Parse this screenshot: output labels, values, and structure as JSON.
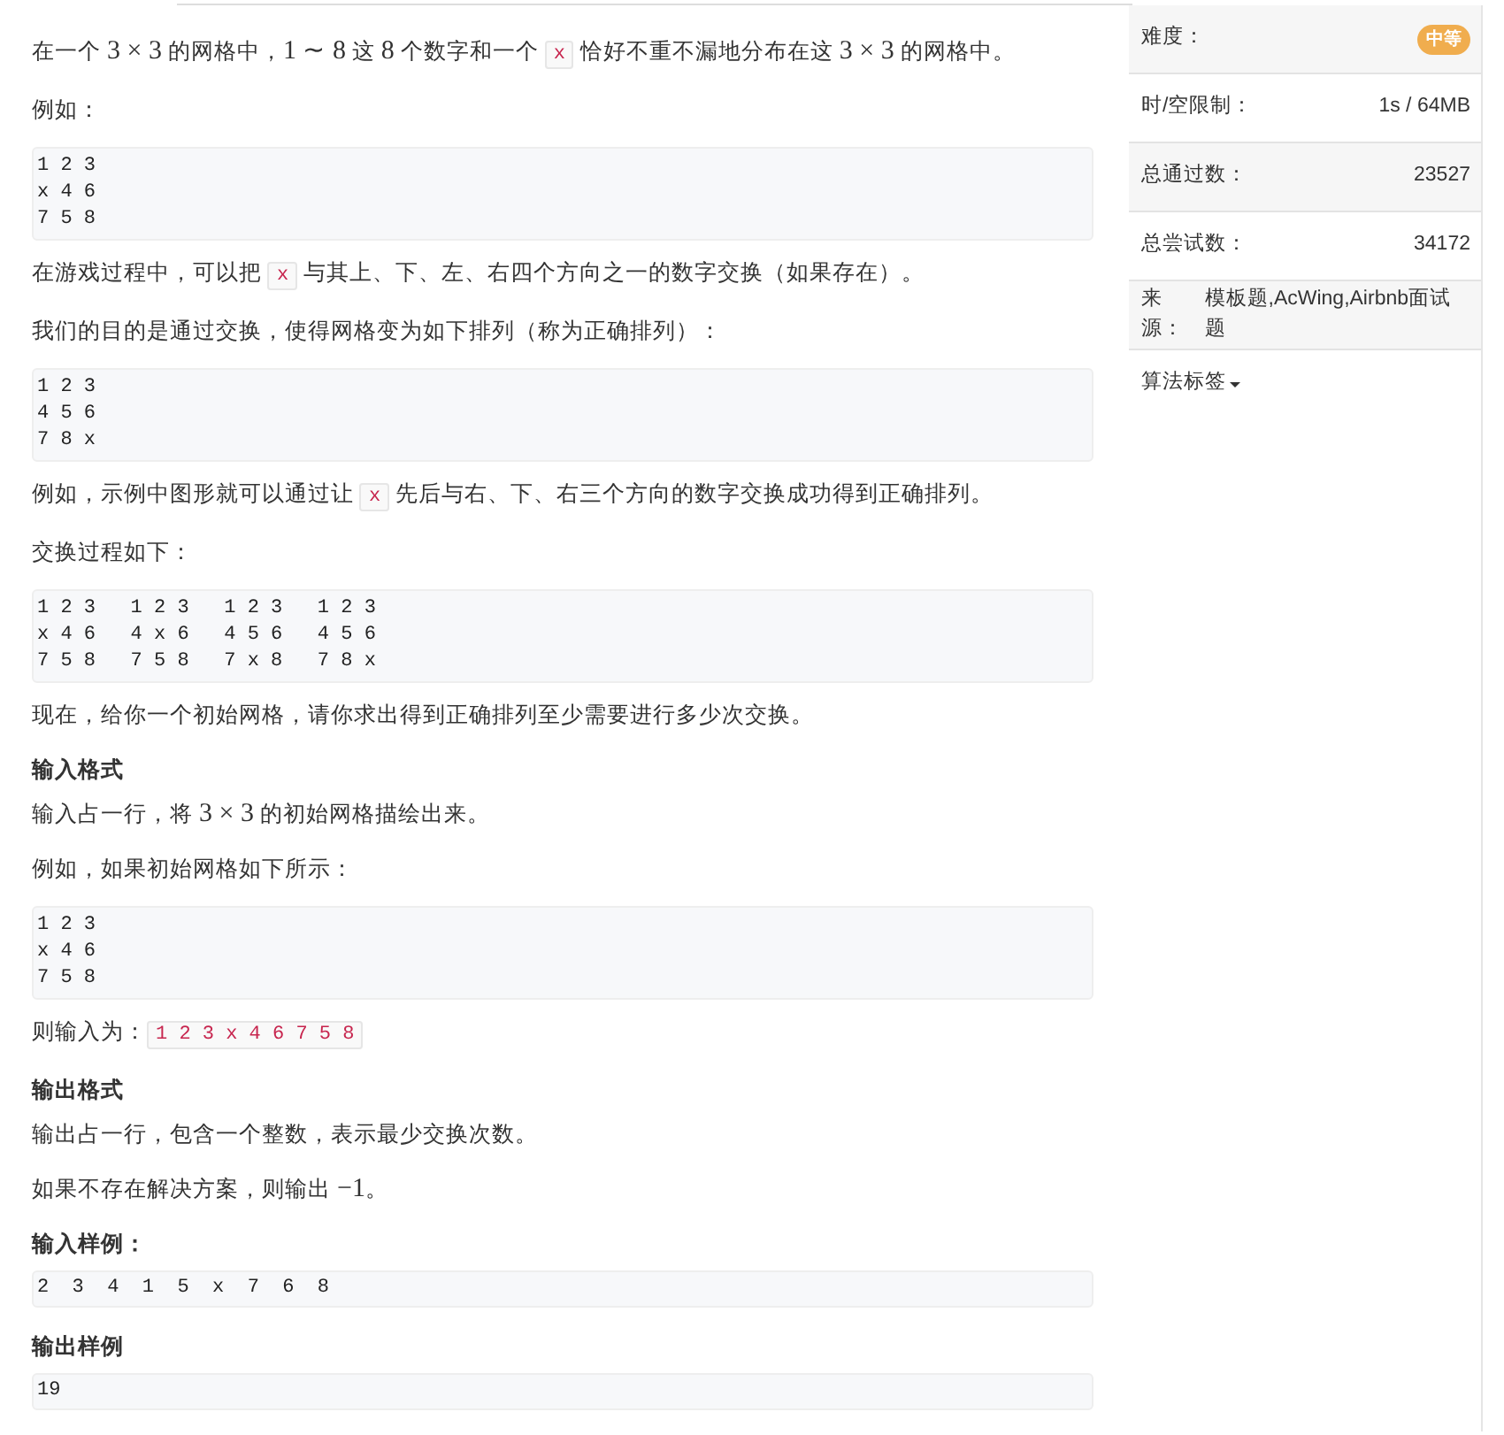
{
  "content": [
    {
      "kind": "paragraph",
      "parts": [
        {
          "kind": "text",
          "text": "在一个 "
        },
        {
          "kind": "math",
          "text": "3 × 3"
        },
        {
          "kind": "text",
          "text": " 的网格中，"
        },
        {
          "kind": "math",
          "text": "1 ∼ 8"
        },
        {
          "kind": "text",
          "text": " 这 "
        },
        {
          "kind": "math",
          "text": "8"
        },
        {
          "kind": "text",
          "text": " 个数字和一个 "
        },
        {
          "kind": "code",
          "text": "x"
        },
        {
          "kind": "text",
          "text": " 恰好不重不漏地分布在这 "
        },
        {
          "kind": "math",
          "text": "3 × 3"
        },
        {
          "kind": "text",
          "text": " 的网格中。"
        }
      ]
    },
    {
      "kind": "paragraph",
      "parts": [
        {
          "kind": "text",
          "text": "例如："
        }
      ]
    },
    {
      "kind": "code",
      "lines": [
        "1 2 3",
        "x 4 6",
        "7 5 8"
      ]
    },
    {
      "kind": "paragraph",
      "parts": [
        {
          "kind": "text",
          "text": "在游戏过程中，可以把 "
        },
        {
          "kind": "code",
          "text": "x"
        },
        {
          "kind": "text",
          "text": " 与其上、下、左、右四个方向之一的数字交换（如果存在）。"
        }
      ]
    },
    {
      "kind": "paragraph",
      "parts": [
        {
          "kind": "text",
          "text": "我们的目的是通过交换，使得网格变为如下排列（称为正确排列）："
        }
      ]
    },
    {
      "kind": "code",
      "lines": [
        "1 2 3",
        "4 5 6",
        "7 8 x"
      ]
    },
    {
      "kind": "paragraph",
      "parts": [
        {
          "kind": "text",
          "text": "例如，示例中图形就可以通过让 "
        },
        {
          "kind": "code",
          "text": "x"
        },
        {
          "kind": "text",
          "text": " 先后与右、下、右三个方向的数字交换成功得到正确排列。"
        }
      ]
    },
    {
      "kind": "paragraph",
      "parts": [
        {
          "kind": "text",
          "text": "交换过程如下："
        }
      ]
    },
    {
      "kind": "code",
      "lines": [
        "1 2 3   1 2 3   1 2 3   1 2 3",
        "x 4 6   4 x 6   4 5 6   4 5 6",
        "7 5 8   7 5 8   7 x 8   7 8 x"
      ]
    },
    {
      "kind": "paragraph",
      "parts": [
        {
          "kind": "text",
          "text": "现在，给你一个初始网格，请你求出得到正确排列至少需要进行多少次交换。"
        }
      ]
    },
    {
      "kind": "heading",
      "text": "输入格式"
    },
    {
      "kind": "paragraph",
      "parts": [
        {
          "kind": "text",
          "text": "输入占一行，将 "
        },
        {
          "kind": "math",
          "text": "3 × 3"
        },
        {
          "kind": "text",
          "text": " 的初始网格描绘出来。"
        }
      ]
    },
    {
      "kind": "paragraph",
      "parts": [
        {
          "kind": "text",
          "text": "例如，如果初始网格如下所示："
        }
      ]
    },
    {
      "kind": "code",
      "lines": [
        "1 2 3",
        "x 4 6",
        "7 5 8"
      ]
    },
    {
      "kind": "paragraph",
      "parts": [
        {
          "kind": "text",
          "text": "则输入为："
        },
        {
          "kind": "code",
          "text": "1 2 3 x 4 6 7 5 8"
        }
      ]
    },
    {
      "kind": "heading",
      "text": "输出格式"
    },
    {
      "kind": "paragraph",
      "parts": [
        {
          "kind": "text",
          "text": "输出占一行，包含一个整数，表示最少交换次数。"
        }
      ]
    },
    {
      "kind": "paragraph",
      "parts": [
        {
          "kind": "text",
          "text": "如果不存在解决方案，则输出 "
        },
        {
          "kind": "math",
          "text": "−1"
        },
        {
          "kind": "text",
          "text": "。"
        }
      ]
    },
    {
      "kind": "heading",
      "text": "输入样例："
    },
    {
      "kind": "sample",
      "lines": [
        "2  3  4  1  5  x  7  6  8"
      ]
    },
    {
      "kind": "heading",
      "text": "输出样例"
    },
    {
      "kind": "sample",
      "lines": [
        "19"
      ]
    }
  ],
  "sidebar": {
    "rows": [
      {
        "kind": "badge",
        "label": "难度：",
        "value": "中等"
      },
      {
        "kind": "text",
        "label": "时/空限制：",
        "value": "1s / 64MB"
      },
      {
        "kind": "text",
        "label": "总通过数：",
        "value": "23527"
      },
      {
        "kind": "text",
        "label": "总尝试数：",
        "value": "34172"
      },
      {
        "kind": "text",
        "label": "来源：",
        "value": "模板题,AcWing,Airbnb面试题"
      }
    ],
    "tags_toggle": {
      "label": "算法标签"
    }
  }
}
